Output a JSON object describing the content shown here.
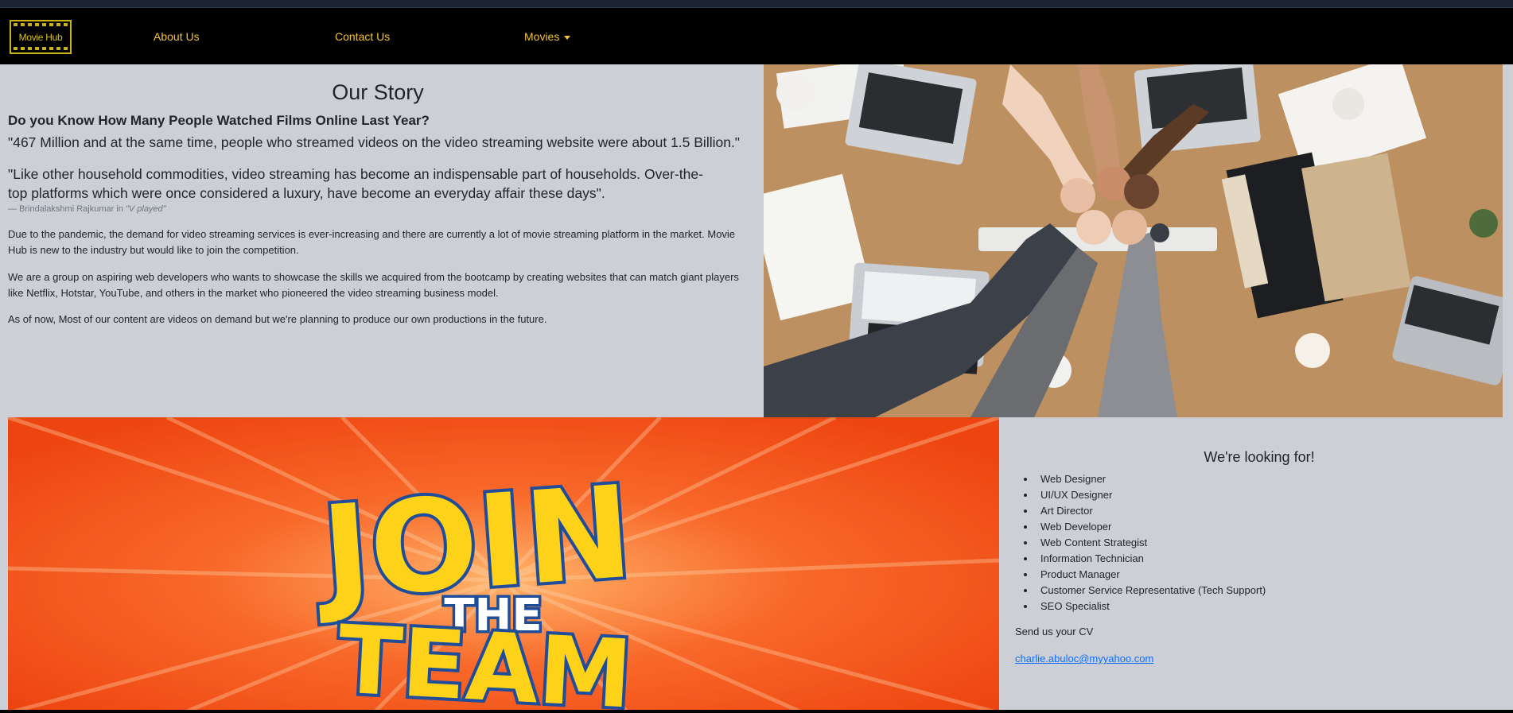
{
  "nav": {
    "logo_text": "Movie Hub",
    "about": "About Us",
    "contact": "Contact Us",
    "movies": "Movies"
  },
  "story": {
    "title": "Our Story",
    "question": "Do you Know How Many People Watched Films Online Last Year?",
    "quote1": "\"467 Million and at the same time, people who streamed videos on the video streaming website were about 1.5 Billion.\"",
    "quote2": "\"Like other household commodities, video streaming has become an indispensable part of households. Over-the-top platforms which were once considered a luxury, have become an everyday affair these days\".",
    "cite_author": "— Brindalakshmi Rajkumar in",
    "cite_source": "\"V played\"",
    "para1": "Due to the pandemic, the demand for video streaming services is ever-increasing and there are currently a lot of movie streaming platform in the market. Movie Hub is new to the industry but would like to join the competition.",
    "para2": "We are a group on aspiring web developers who wants to showcase the skills we acquired from the bootcamp by creating websites that can match giant players like Netflix, Hotstar, YouTube, and others in the market who pioneered the video streaming business model.",
    "para3": "As of now, Most of our content are videos on demand but we're planning to produce our own productions in the future."
  },
  "banner": {
    "word1": "JOIN",
    "word2": "THE",
    "word3": "TEAM"
  },
  "looking": {
    "title": "We're looking for!",
    "roles": [
      "Web Designer",
      "UI/UX Designer",
      "Art Director",
      "Web Developer",
      "Web Content Strategist",
      "Information Technician",
      "Product Manager",
      "Customer Service Representative (Tech Support)",
      "SEO Specialist"
    ],
    "send_text": "Send us your CV",
    "email": "charlie.abuloc@myyahoo.com"
  },
  "colors": {
    "nav_bg": "#000000",
    "nav_link": "#f4c430",
    "content_bg": "#ccd0d6",
    "banner_orange": "#f04a10",
    "banner_yellow": "#ffd21a",
    "link_blue": "#0d6efd"
  }
}
